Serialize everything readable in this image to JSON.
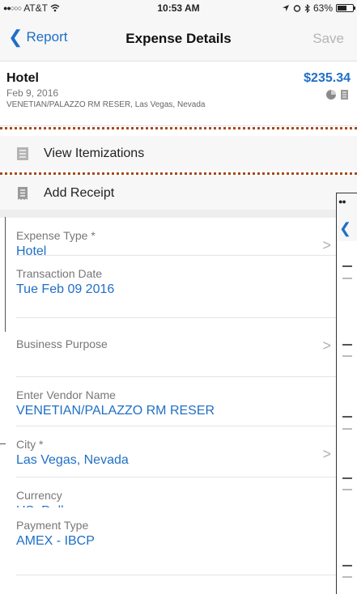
{
  "status_bar": {
    "carrier": "AT&T",
    "time": "10:53 AM",
    "battery_percent": "63%",
    "battery_level": 0.63
  },
  "nav": {
    "back_label": "Report",
    "title": "Expense Details",
    "save_label": "Save"
  },
  "expense": {
    "name": "Hotel",
    "date": "Feb 9, 2016",
    "vendor_location": "VENETIAN/PALAZZO RM RESER, Las Vegas, Nevada",
    "amount": "$235.34"
  },
  "actions": {
    "view_itemizations": "View Itemizations",
    "add_receipt": "Add Receipt"
  },
  "fields": [
    {
      "label": "Expense Type *",
      "value": "Hotel"
    },
    {
      "label": "Transaction Date",
      "value": "Tue Feb 09 2016"
    },
    {
      "label": "Business Purpose",
      "value": ""
    },
    {
      "label": "Enter Vendor Name",
      "value": "VENETIAN/PALAZZO RM RESER"
    },
    {
      "label": "City *",
      "value": "Las Vegas, Nevada"
    },
    {
      "label": "Currency",
      "value": "US, Dollar"
    },
    {
      "label": "Payment Type",
      "value": "AMEX - IBCP"
    }
  ],
  "colors": {
    "accent": "#1f6fc6",
    "dotted_line": "#a6491d",
    "label": "#777777"
  }
}
